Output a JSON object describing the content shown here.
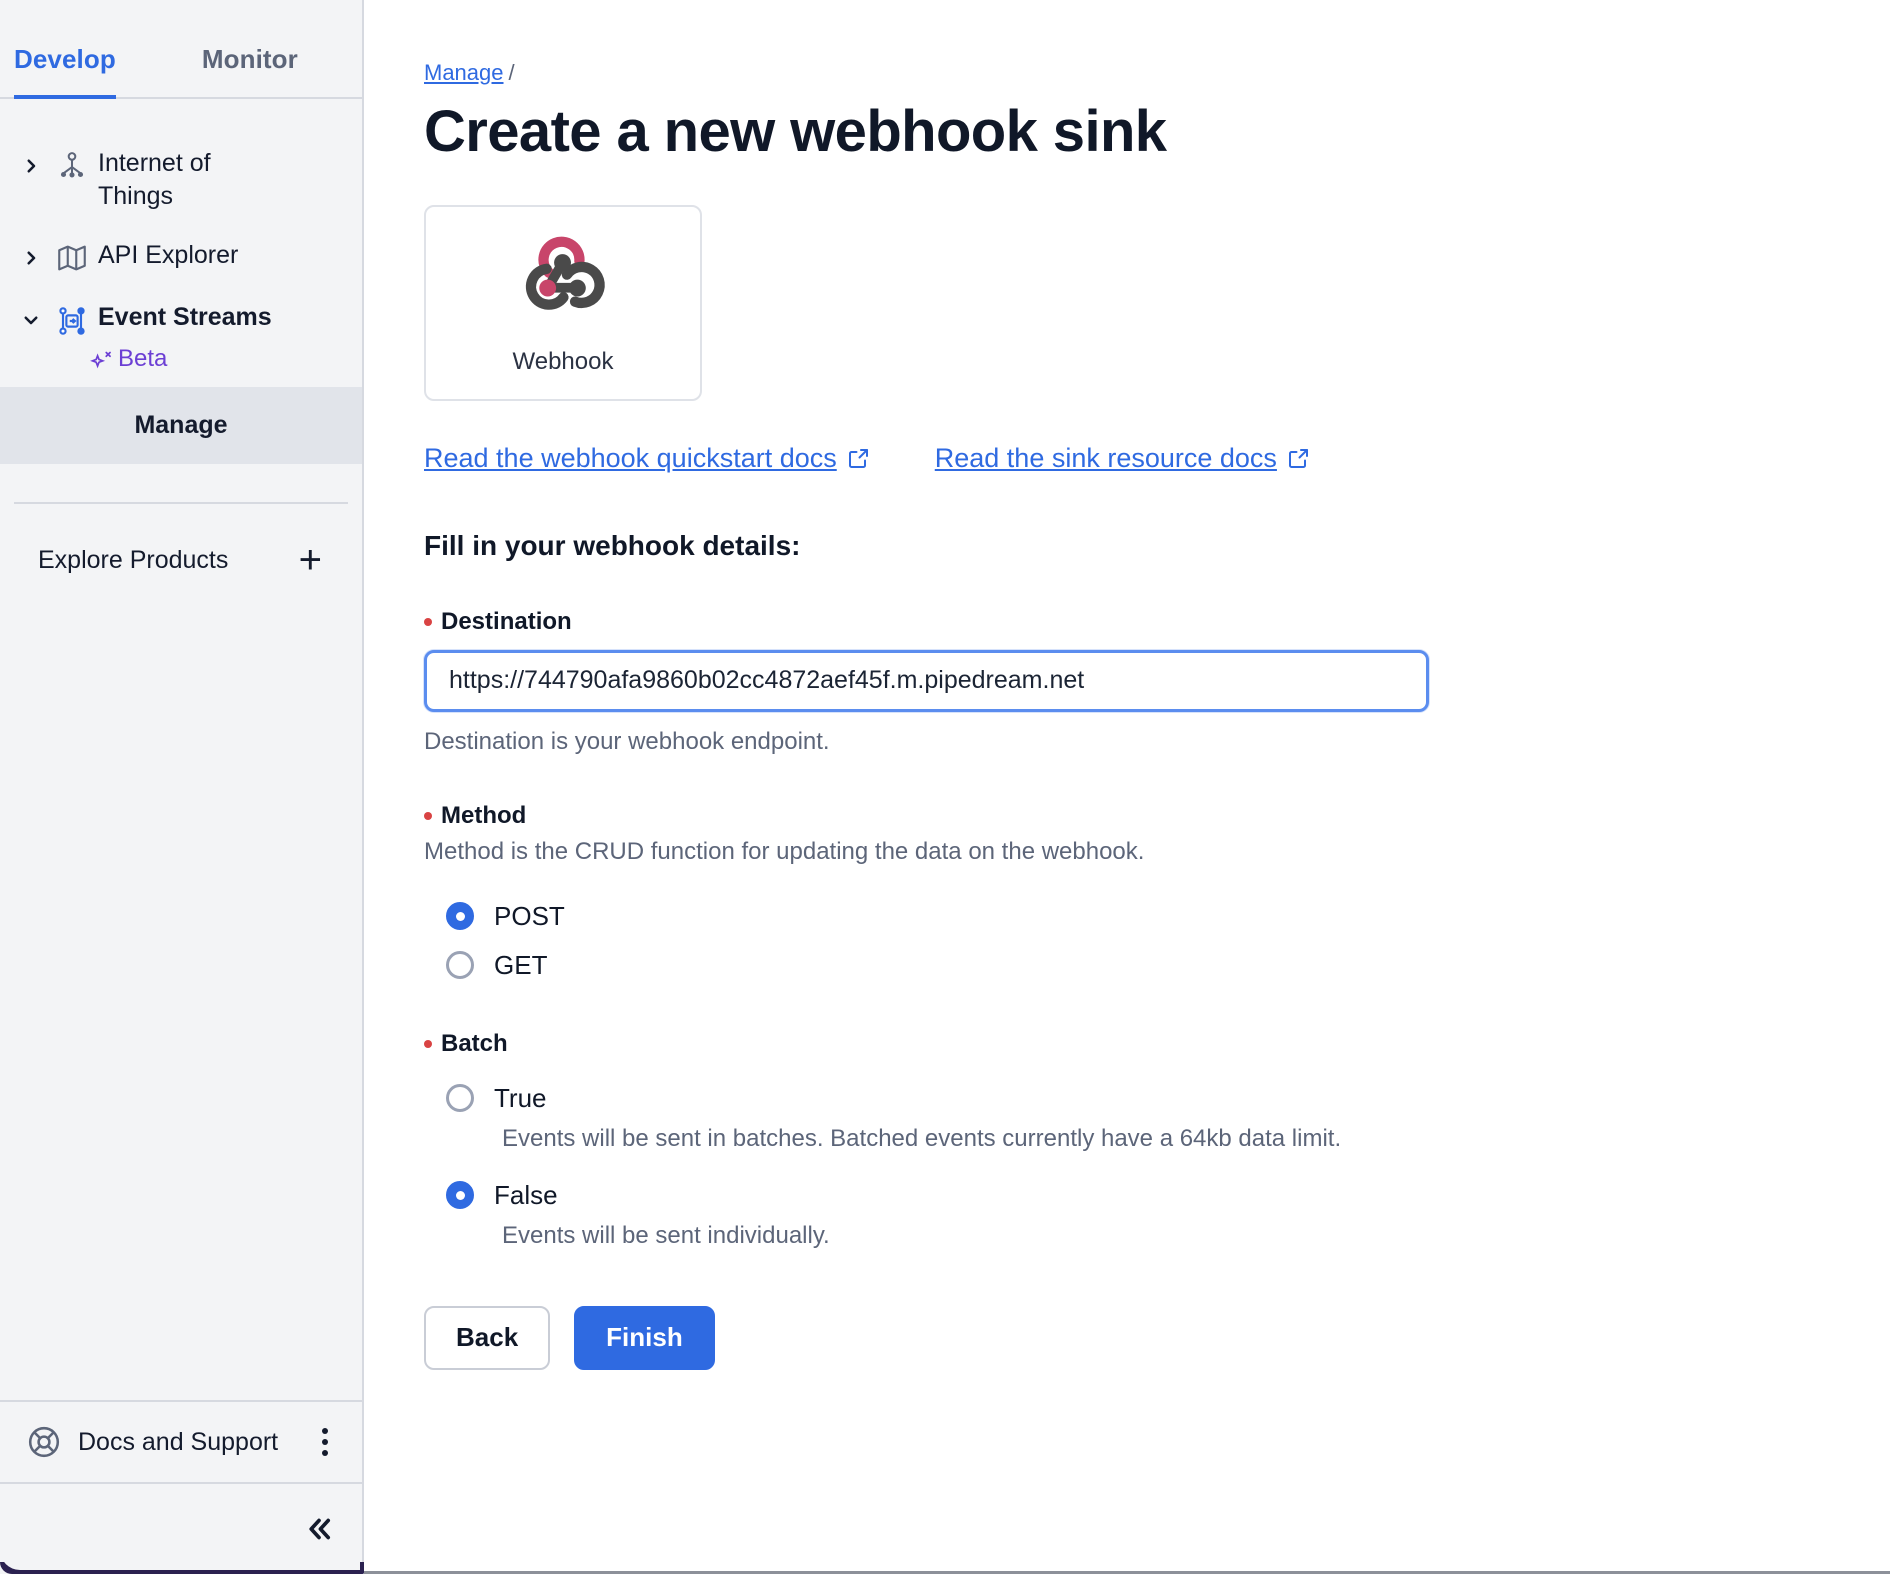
{
  "sidebar": {
    "tabs": [
      {
        "label": "Develop",
        "active": true
      },
      {
        "label": "Monitor",
        "active": false
      }
    ],
    "nav_items": [
      {
        "label": "Internet of Things",
        "icon": "iot-icon",
        "expanded": false,
        "bold": false
      },
      {
        "label": "API Explorer",
        "icon": "map-icon",
        "expanded": false,
        "bold": false
      },
      {
        "label": "Event Streams",
        "icon": "event-streams-icon",
        "expanded": true,
        "bold": true
      }
    ],
    "beta_badge": "Beta",
    "sub_item": "Manage",
    "explore_products": "Explore Products",
    "add_icon": "+",
    "docs_and_support": "Docs and Support"
  },
  "main": {
    "breadcrumb": {
      "parent": "Manage",
      "separator": "/"
    },
    "page_title": "Create a new webhook sink",
    "connector_card": {
      "label": "Webhook",
      "icon": "webhook-logo"
    },
    "links": [
      {
        "label": "Read the webhook quickstart docs",
        "icon": "external-link-icon"
      },
      {
        "label": "Read the sink resource docs",
        "icon": "external-link-icon"
      }
    ],
    "section_heading": "Fill in your webhook details:",
    "fields": {
      "destination": {
        "label": "Destination",
        "required": true,
        "value": "https://744790afa9860b02cc4872aef45f.m.pipedream.net",
        "placeholder": "https://",
        "helper": "Destination is your webhook endpoint."
      },
      "method": {
        "label": "Method",
        "required": true,
        "helper": "Method is the CRUD function for updating the data on the webhook.",
        "options": [
          {
            "label": "POST",
            "selected": true
          },
          {
            "label": "GET",
            "selected": false
          }
        ]
      },
      "batch": {
        "label": "Batch",
        "required": true,
        "options": [
          {
            "label": "True",
            "selected": false,
            "description": "Events will be sent in batches. Batched events currently have a 64kb data limit."
          },
          {
            "label": "False",
            "selected": true,
            "description": "Events will be sent individually."
          }
        ]
      }
    },
    "buttons": {
      "back": "Back",
      "finish": "Finish"
    }
  },
  "colors": {
    "accent_blue": "#2f6ae1",
    "beta_purple": "#6c3fd4",
    "required_red": "#d94343",
    "webhook_pink": "#c8456a",
    "webhook_dark": "#4a4a4a",
    "sidebar_bg": "#f3f4f6",
    "active_item_bg": "#e1e4ea"
  }
}
